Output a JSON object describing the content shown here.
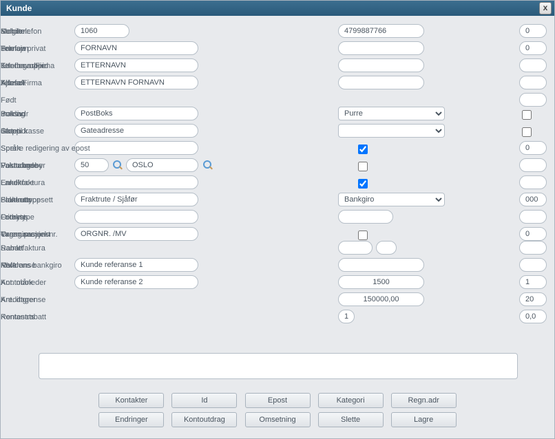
{
  "window": {
    "title": "Kunde",
    "close": "x"
  },
  "col1": {
    "kundenr": {
      "label": "Kundenr.",
      "value": "1060"
    },
    "fornavn": {
      "label": "Fornavn",
      "value": "FORNAVN"
    },
    "etternavn": {
      "label": "Etternavn/Firma",
      "value": "ETTERNAVN"
    },
    "alfasok": {
      "label": "Alfasøk",
      "value": "ETTERNAVN FORNAVN"
    },
    "boksadr": {
      "label": "Boksadr",
      "value": "PostBoks"
    },
    "gateadr": {
      "label": "Gateadr",
      "value": "Gateadresse"
    },
    "gateadr2": {
      "value": ""
    },
    "postadresse": {
      "label": "Postadresse",
      "nr": "50",
      "sted": "OSLO"
    },
    "land": {
      "label": "Land",
      "value": ""
    },
    "fraktrute": {
      "label": "Fraktrute",
      "value": "Fraktrute / Sjåfør"
    },
    "fritekst": {
      "label": "Fritekst",
      "value": ""
    },
    "orgnr": {
      "label": "Organisasjonsnr.",
      "value": "ORGNR. /MV"
    },
    "referanse": {
      "label": "Referanse",
      "v1": "Kunde referanse 1",
      "v2": "Kunde referanse 2"
    }
  },
  "col2": {
    "mobil": {
      "label": "Mobiltelefon",
      "value": "4799887766"
    },
    "tlfpriv": {
      "label": "Telefon privat",
      "value": ""
    },
    "tlfarb": {
      "label": "Telefon arbeid",
      "value": ""
    },
    "telefax": {
      "label": "Telefax",
      "value": ""
    },
    "purring": {
      "label": "Purring",
      "value": "Purre"
    },
    "stopp": {
      "label": "Stopp",
      "value": ""
    },
    "sperreepost": {
      "label": "Sperre redigering av epost",
      "checked": true
    },
    "fakturagebyr": {
      "label": "Fakturagebyr",
      "checked": false
    },
    "enkeltfaktura": {
      "label": "Enkeltfaktura",
      "checked": true
    },
    "fakturatype": {
      "label": "Fakturatype",
      "value": "Bankgiro"
    },
    "ordretype": {
      "label": "Ordretype",
      "value": ""
    },
    "tvangprosjekt": {
      "label": "Tvang prosjekt",
      "checked": false
    },
    "samlefaktura": {
      "label": "Samlefaktura",
      "v1": "",
      "v2": ""
    },
    "kundensbankgiro": {
      "label": "Kundens bankgiro",
      "value": ""
    },
    "kontobok": {
      "label": "Kontobok",
      "value": "1500"
    },
    "kredittgrense": {
      "label": "Kredittgrense",
      "value": "150000,00"
    },
    "rentesats": {
      "label": "Rentesats",
      "value": "1"
    }
  },
  "col3": {
    "selger": {
      "label": "Selger",
      "value": "0"
    },
    "bransje": {
      "label": "Bransje",
      "value": "0"
    },
    "kundegruppe": {
      "label": "Kundegruppe",
      "value": ""
    },
    "kjonn": {
      "label": "Kjønn/Firma",
      "value": ""
    },
    "fodt": {
      "label": "Født",
      "value": ""
    },
    "inaktiv": {
      "label": "Inaktiv",
      "checked": false
    },
    "ikketilkasse": {
      "label": "Ikke til kasse",
      "checked": false
    },
    "sprak": {
      "label": "Språk",
      "value": "0"
    },
    "valutakode": {
      "label": "Valutakode",
      "value": ""
    },
    "landkode": {
      "label": "Landkode",
      "value": ""
    },
    "blankett": {
      "label": "Blankettoppsett",
      "value": "000"
    },
    "fornyes": {
      "label": "Fornyes",
      "value": ""
    },
    "varenummer": {
      "label": "Varenummer",
      "value": "0"
    },
    "rabatt": {
      "label": "Rabatt",
      "value": ""
    },
    "mva": {
      "label": "MVA",
      "value": ""
    },
    "antmnd": {
      "label": "Ant. måneder",
      "value": "1"
    },
    "antdager": {
      "label": "Ant. dager",
      "value": "20"
    },
    "kontantrabatt": {
      "label": "Kontantrabatt",
      "value": "0,0"
    }
  },
  "buttons": {
    "kontakter": "Kontakter",
    "id": "Id",
    "epost": "Epost",
    "kategori": "Kategori",
    "regnadr": "Regn.adr",
    "endringer": "Endringer",
    "kontoutdrag": "Kontoutdrag",
    "omsetning": "Omsetning",
    "slette": "Slette",
    "lagre": "Lagre"
  }
}
